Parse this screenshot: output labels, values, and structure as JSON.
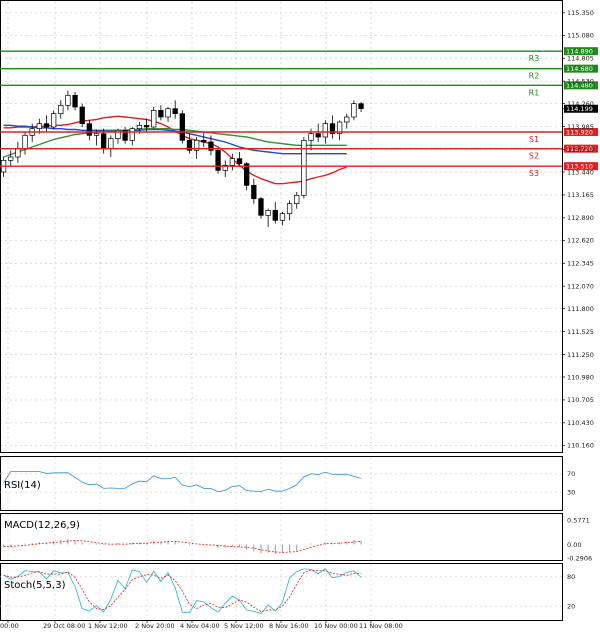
{
  "chart_data": {
    "type": "candlestick",
    "ylim": [
      110.08,
      115.48
    ],
    "price_ticks": [
      "115.350",
      "115.080",
      "114.805",
      "114.530",
      "114.260",
      "113.985",
      "113.710",
      "113.440",
      "113.165",
      "112.890",
      "112.620",
      "112.345",
      "112.070",
      "111.800",
      "111.525",
      "111.250",
      "110.980",
      "110.705",
      "110.430",
      "110.160"
    ],
    "time_labels": [
      "00:00",
      "29 Oct 08:00",
      "1 Nov 12:00",
      "2 Nov 20:00",
      "4 Nov 04:00",
      "5 Nov 12:00",
      "8 Nov 16:00",
      "10 Nov 00:00",
      "11 Nov 08:00"
    ],
    "current_price": "114.199",
    "levels": [
      {
        "name": "R3",
        "price": 114.89,
        "tag": "114.890",
        "color": "#1e8a1e"
      },
      {
        "name": "R2",
        "price": 114.68,
        "tag": "114.680",
        "color": "#1e8a1e"
      },
      {
        "name": "R1",
        "price": 114.48,
        "tag": "114.480",
        "color": "#1e8a1e"
      },
      {
        "name": "S1",
        "price": 113.92,
        "tag": "113.920",
        "color": "#e02020"
      },
      {
        "name": "S2",
        "price": 113.72,
        "tag": "113.720",
        "color": "#e02020"
      },
      {
        "name": "S3",
        "price": 113.51,
        "tag": "113.510",
        "color": "#e02020"
      }
    ],
    "candles": [
      [
        113.44,
        113.62,
        113.38,
        113.58
      ],
      [
        113.58,
        113.7,
        113.5,
        113.62
      ],
      [
        113.62,
        113.8,
        113.55,
        113.72
      ],
      [
        113.72,
        113.92,
        113.65,
        113.88
      ],
      [
        113.88,
        114.02,
        113.8,
        113.96
      ],
      [
        113.96,
        114.08,
        113.9,
        114.02
      ],
      [
        114.02,
        114.12,
        113.92,
        113.98
      ],
      [
        113.98,
        114.18,
        113.95,
        114.14
      ],
      [
        114.14,
        114.3,
        114.08,
        114.24
      ],
      [
        114.24,
        114.42,
        114.18,
        114.36
      ],
      [
        114.36,
        114.4,
        114.18,
        114.22
      ],
      [
        114.22,
        114.26,
        113.98,
        114.02
      ],
      [
        114.02,
        114.06,
        113.82,
        113.88
      ],
      [
        113.88,
        113.95,
        113.76,
        113.9
      ],
      [
        113.9,
        113.96,
        113.66,
        113.72
      ],
      [
        113.72,
        113.88,
        113.62,
        113.84
      ],
      [
        113.84,
        113.96,
        113.78,
        113.94
      ],
      [
        113.94,
        113.98,
        113.78,
        113.82
      ],
      [
        113.82,
        113.98,
        113.76,
        113.96
      ],
      [
        113.96,
        114.04,
        113.9,
        114.0
      ],
      [
        114.0,
        114.08,
        113.92,
        113.98
      ],
      [
        113.98,
        114.22,
        113.96,
        114.18
      ],
      [
        114.18,
        114.24,
        114.06,
        114.1
      ],
      [
        114.1,
        114.22,
        114.04,
        114.2
      ],
      [
        114.2,
        114.3,
        114.08,
        114.14
      ],
      [
        114.14,
        114.18,
        113.78,
        113.82
      ],
      [
        113.82,
        113.9,
        113.66,
        113.7
      ],
      [
        113.7,
        113.86,
        113.6,
        113.82
      ],
      [
        113.82,
        113.92,
        113.74,
        113.8
      ],
      [
        113.8,
        113.88,
        113.64,
        113.7
      ],
      [
        113.7,
        113.72,
        113.42,
        113.46
      ],
      [
        113.46,
        113.58,
        113.38,
        113.52
      ],
      [
        113.52,
        113.66,
        113.46,
        113.6
      ],
      [
        113.6,
        113.68,
        113.5,
        113.54
      ],
      [
        113.54,
        113.56,
        113.22,
        113.28
      ],
      [
        113.28,
        113.36,
        113.06,
        113.12
      ],
      [
        113.12,
        113.14,
        112.88,
        112.92
      ],
      [
        112.92,
        113.0,
        112.78,
        112.98
      ],
      [
        112.98,
        113.08,
        112.82,
        112.86
      ],
      [
        112.86,
        112.96,
        112.8,
        112.94
      ],
      [
        112.94,
        113.1,
        112.86,
        113.06
      ],
      [
        113.06,
        113.2,
        113.0,
        113.16
      ],
      [
        113.16,
        113.86,
        113.12,
        113.82
      ],
      [
        113.82,
        113.96,
        113.7,
        113.9
      ],
      [
        113.9,
        114.02,
        113.8,
        113.86
      ],
      [
        113.86,
        114.06,
        113.78,
        114.02
      ],
      [
        114.02,
        114.12,
        113.84,
        113.9
      ],
      [
        113.9,
        114.06,
        113.82,
        114.04
      ],
      [
        114.04,
        114.14,
        113.96,
        114.1
      ],
      [
        114.1,
        114.3,
        114.06,
        114.26
      ],
      [
        114.26,
        114.28,
        114.16,
        114.2
      ]
    ],
    "ma_series": [
      {
        "color": "#e02020",
        "values": [
          113.97,
          113.97,
          113.98,
          113.98,
          113.98,
          113.99,
          113.99,
          114.0,
          114.0,
          114.01,
          114.03,
          114.05,
          114.06,
          114.07,
          114.09,
          114.1,
          114.11,
          114.1,
          114.09,
          114.08,
          114.07,
          114.05,
          114.02,
          113.98,
          113.93,
          113.88,
          113.84,
          113.82,
          113.8,
          113.78,
          113.74,
          113.68,
          113.6,
          113.52,
          113.45,
          113.4,
          113.36,
          113.33,
          113.3,
          113.3,
          113.31,
          113.32,
          113.33,
          113.36,
          113.38,
          113.4,
          113.43,
          113.47,
          113.5
        ]
      },
      {
        "color": "#2346d8",
        "values": [
          114.0,
          114.0,
          113.99,
          113.99,
          113.98,
          113.97,
          113.97,
          113.96,
          113.96,
          113.95,
          113.95,
          113.94,
          113.94,
          113.94,
          113.94,
          113.94,
          113.94,
          113.94,
          113.94,
          113.94,
          113.95,
          113.95,
          113.95,
          113.94,
          113.93,
          113.92,
          113.9,
          113.88,
          113.86,
          113.84,
          113.82,
          113.8,
          113.77,
          113.74,
          113.72,
          113.7,
          113.69,
          113.68,
          113.67,
          113.66,
          113.66,
          113.66,
          113.66,
          113.66,
          113.66,
          113.66,
          113.66,
          113.66,
          113.66
        ]
      },
      {
        "color": "#3b8a3b",
        "values": [
          113.62,
          113.65,
          113.68,
          113.71,
          113.74,
          113.77,
          113.8,
          113.83,
          113.85,
          113.87,
          113.89,
          113.9,
          113.91,
          113.92,
          113.93,
          113.93,
          113.94,
          113.94,
          113.95,
          113.95,
          113.96,
          113.96,
          113.96,
          113.96,
          113.95,
          113.95,
          113.94,
          113.93,
          113.92,
          113.91,
          113.9,
          113.89,
          113.88,
          113.87,
          113.86,
          113.84,
          113.82,
          113.8,
          113.79,
          113.78,
          113.77,
          113.76,
          113.76,
          113.76,
          113.76,
          113.76,
          113.76,
          113.76,
          113.76
        ]
      }
    ],
    "indicators": {
      "rsi": {
        "label": "RSI(14)",
        "levels": [
          "70",
          "30"
        ]
      },
      "macd": {
        "label": "MACD(12,26,9)",
        "ticks": [
          "0.5771",
          "0.00",
          "-0.2906"
        ]
      },
      "stoch": {
        "label": "Stoch(5,5,3)",
        "levels": [
          "80",
          "20"
        ]
      }
    }
  }
}
